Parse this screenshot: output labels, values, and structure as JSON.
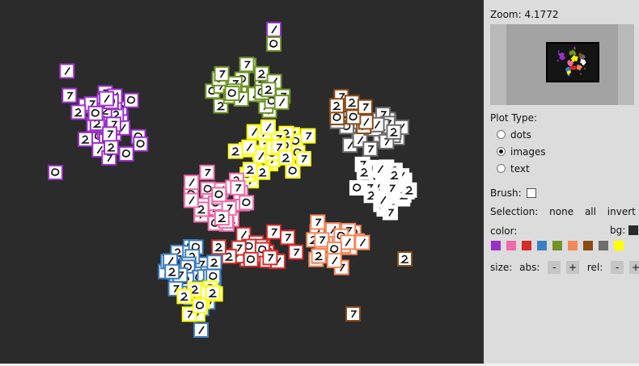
{
  "zoom": {
    "label": "Zoom:",
    "value": "4.1772"
  },
  "plot_type": {
    "label": "Plot Type:",
    "options": [
      "dots",
      "images",
      "text"
    ],
    "selected": "images"
  },
  "brush": {
    "label": "Brush:",
    "checked": false
  },
  "selection": {
    "label": "Selection:",
    "none": "none",
    "all": "all",
    "invert": "invert"
  },
  "color": {
    "label": "color:",
    "bg_label": "bg:",
    "bg_color": "#2b2b2b",
    "swatches": [
      "#9b30c9",
      "#f06aa8",
      "#d42b2b",
      "#3c7fc0",
      "#6f9427",
      "#f5875a",
      "#8b4a16",
      "#6e6e6e",
      "#ffff00"
    ]
  },
  "size": {
    "label": "size:",
    "abs_label": "abs:",
    "rel_label": "rel:",
    "minus": "-",
    "plus": "+"
  },
  "digit_colors": [
    "#9b30c9",
    "#f06aa8",
    "#d42b2b",
    "#3c7fc0",
    "#6f9427",
    "#f5875a",
    "#8b4a16",
    "#6e6e6e",
    "#ffff00",
    "#ffffff"
  ]
}
